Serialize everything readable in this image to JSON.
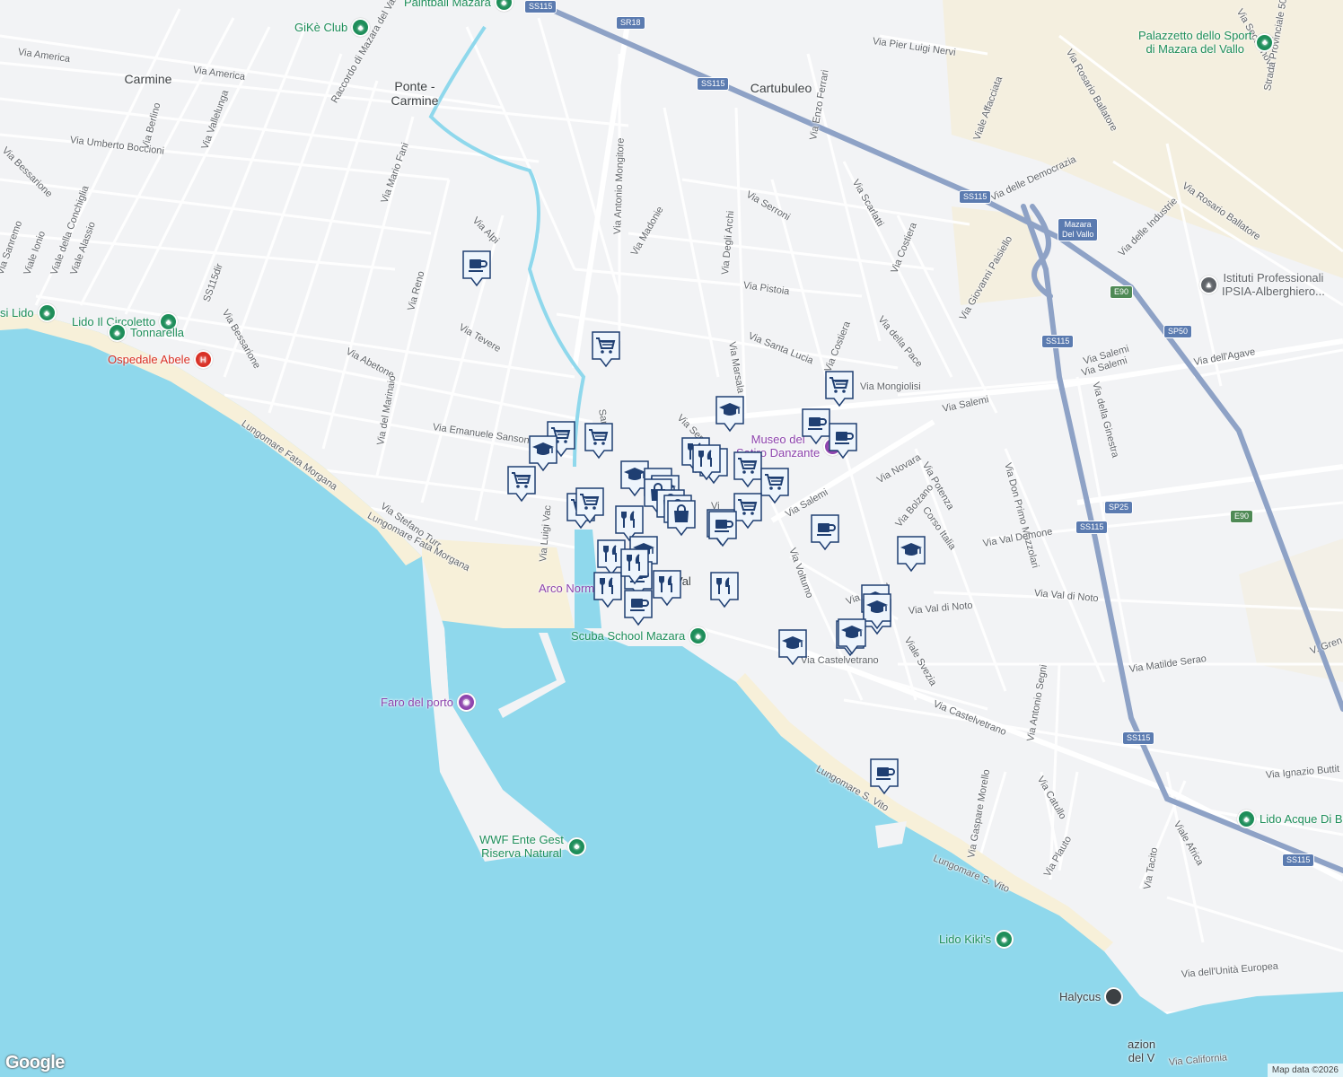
{
  "map": {
    "colors": {
      "water": "#8fd8ec",
      "land": "#f2f3f5",
      "road": "#ffffff",
      "highway": "#8ea2c6",
      "beach": "#f7f0d9",
      "park": "#f4eedd",
      "poi_green": "#1e8e5a",
      "poi_purple": "#8e44ad",
      "hospital": "#d93025",
      "marker": "#1f3f72"
    },
    "place_labels": [
      {
        "text": "Carmine"
      },
      {
        "text": "Ponte -\nCarmine"
      },
      {
        "text": "Cartubuleo"
      }
    ],
    "street_labels": [
      "Via America",
      "Via America",
      "Raccordo di Mazara del Vallo",
      "Via Umberto Boccioni",
      "Via Vallelunga",
      "Via Berlino",
      "Via Bessarione",
      "Via Sanremo",
      "Viale Ionio",
      "Viale della Conchiglia",
      "Viale Alassio",
      "Via Mario Fani",
      "SS115dir",
      "Via Bessarione",
      "Via Reno",
      "Via Alpi",
      "Via Tevere",
      "Via Abetone",
      "Via del Marinaio",
      "Via Emanuele Sansone",
      "Lungomare Fata Morgana",
      "Via Stefano Turr",
      "Lungomare Fata Morgana",
      "Via Luigi Vac",
      "Via Antonio Mongitore",
      "Via Madonie",
      "Santa M",
      "Via Degli Archi",
      "Via Serroni",
      "Via Pistoia",
      "Via Marsala",
      "Via Santa Lucia",
      "Via Scarlatti",
      "Via Costiera",
      "Via Costiera",
      "Via della Pace",
      "Via Enzo Ferrari",
      "Via Pier Luigi Nervi",
      "Via Mongiolisi",
      "Via Salemi",
      "Via Salemi",
      "Via Novara",
      "Via Potenza",
      "Via Bolzano",
      "Corso Italia",
      "Via Don Primo Mazzolari",
      "Via Val Demone",
      "Via Val di Noto",
      "Via Val di Noto",
      "Via Voltumo",
      "Via Salemi",
      "Via Castelvetrano",
      "Via Castelvetrano",
      "Viale Svezia",
      "Via Pirand",
      "Via Antonio Segni",
      "Via Matilde Serao",
      "Via Catullo",
      "Via Gaspare Morello",
      "Via Plauto",
      "Via Tacito",
      "Viale Africa",
      "Lungomare S. Vito",
      "Lungomare S. Vito",
      "Via dell'Unità Europea",
      "Via California",
      "Via Ignazio Buttit",
      "Via della Ginestra",
      "Via dell'Agave",
      "Via delle Industrie",
      "Via Rosario Ballatore",
      "Via Rosario Ballatore",
      "Viale Affacciata",
      "Via Giovanni Paisiello",
      "Via delle Democrazia",
      "Via Secolonovo",
      "Strada Provinciale 50",
      "V. Gren",
      "Via Salemi",
      "Via Serr",
      "Vi"
    ],
    "shields": [
      "SS115",
      "SR18",
      "SS115",
      "SS115",
      "SS115",
      "SS115",
      "SS115",
      "SS115",
      "E90",
      "E90",
      "SP50",
      "SP25",
      "Mazara\nDel Vallo"
    ],
    "pois": [
      {
        "text": "Paintball Mazara",
        "kind": "green"
      },
      {
        "text": "GiKè Club",
        "kind": "green"
      },
      {
        "text": "Palazzetto dello Sport\ndi Mazara del Vallo",
        "kind": "green"
      },
      {
        "text": "Istituti Professionali\nIPSIA-Alberghiero...",
        "kind": "gray"
      },
      {
        "text": "si Lido",
        "kind": "green"
      },
      {
        "text": "Lido Il Circoletto",
        "kind": "green"
      },
      {
        "text": "Tonnarella",
        "kind": "green"
      },
      {
        "text": "Ospedale Abele",
        "kind": "hospital"
      },
      {
        "text": "Museo del\nSatiro Danzante",
        "kind": "purple"
      },
      {
        "text": "Arco Normanno",
        "kind": "purple"
      },
      {
        "text": "Scuba School Mazara",
        "kind": "green"
      },
      {
        "text": "Faro del porto",
        "kind": "purple"
      },
      {
        "text": "WWF Ente Gest\nRiserva Natural",
        "kind": "green"
      },
      {
        "text": "Lido Acque Di Buxutu",
        "kind": "green"
      },
      {
        "text": "Lido Kiki's",
        "kind": "green"
      },
      {
        "text": "Halycus",
        "kind": "plain"
      },
      {
        "text": "azion\ndel V",
        "kind": "plain"
      },
      {
        "text": "Val",
        "kind": "plain"
      }
    ],
    "markers": [
      {
        "type": "cafe"
      },
      {
        "type": "grocery"
      },
      {
        "type": "grocery"
      },
      {
        "type": "school"
      },
      {
        "type": "cafe"
      },
      {
        "type": "grocery"
      },
      {
        "type": "grocery"
      },
      {
        "type": "cafe"
      },
      {
        "type": "school"
      },
      {
        "type": "grocery"
      },
      {
        "type": "restaurant"
      },
      {
        "type": "grocery"
      },
      {
        "type": "grocery"
      },
      {
        "type": "school"
      },
      {
        "type": "cafe"
      },
      {
        "type": "school"
      },
      {
        "type": "restaurant"
      },
      {
        "type": "restaurant"
      },
      {
        "type": "grocery"
      },
      {
        "type": "grocery"
      },
      {
        "type": "cafe"
      },
      {
        "type": "shopping"
      },
      {
        "type": "shopping"
      },
      {
        "type": "shopping"
      },
      {
        "type": "shopping"
      },
      {
        "type": "restaurant"
      },
      {
        "type": "cafe"
      },
      {
        "type": "grocery"
      },
      {
        "type": "cafe"
      },
      {
        "type": "school"
      },
      {
        "type": "restaurant"
      },
      {
        "type": "school"
      },
      {
        "type": "cafe"
      },
      {
        "type": "restaurant"
      },
      {
        "type": "restaurant"
      },
      {
        "type": "restaurant"
      },
      {
        "type": "cafe"
      },
      {
        "type": "restaurant"
      },
      {
        "type": "school"
      },
      {
        "type": "school"
      },
      {
        "type": "school"
      },
      {
        "type": "school"
      },
      {
        "type": "school"
      },
      {
        "type": "school"
      },
      {
        "type": "cafe"
      }
    ],
    "attribution": "Map data ©2026",
    "google_logo": "Google"
  }
}
